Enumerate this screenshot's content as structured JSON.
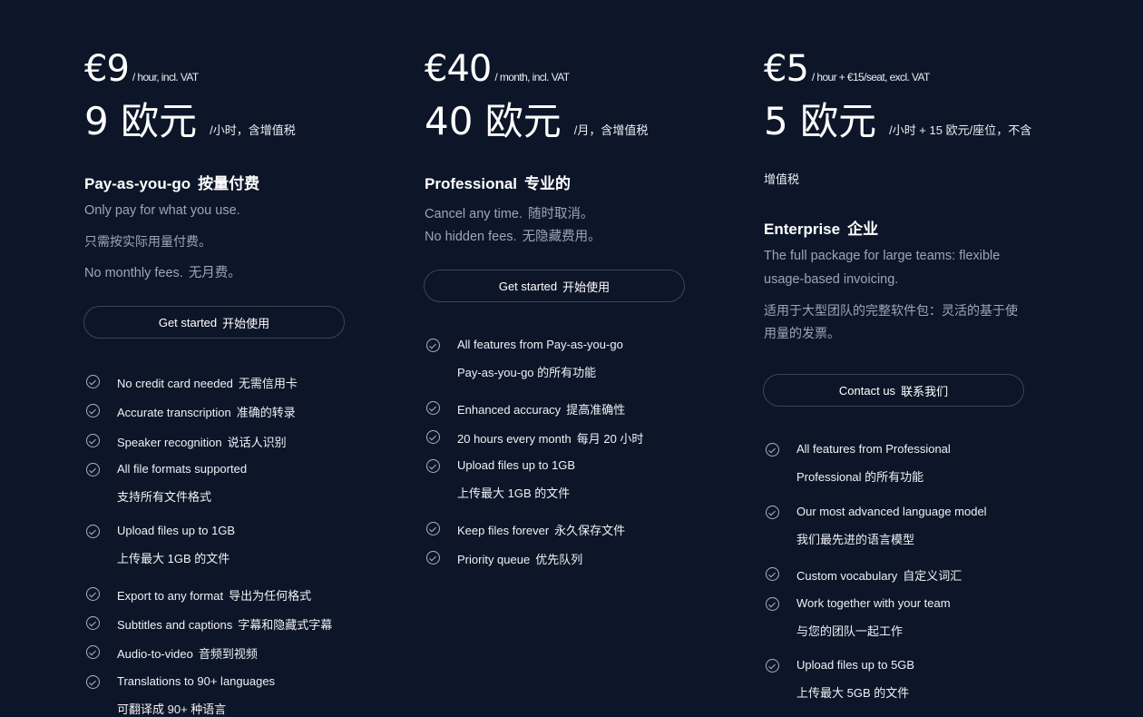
{
  "plans": [
    {
      "price_big": "€9",
      "price_unit": "/ hour, incl. VAT",
      "price_zh_big": "9 欧元",
      "price_zh_unit": "/小时，含增值税",
      "title_en": "Pay-as-you-go",
      "title_zh": "按量付费",
      "desc": [
        {
          "en": "Only pay for what you use.",
          "zh": ""
        },
        {
          "en": "",
          "zh": "只需按实际用量付费。"
        },
        {
          "en": "No monthly fees.",
          "zh": "无月费。"
        }
      ],
      "button_en": "Get started",
      "button_zh": "开始使用",
      "features": [
        {
          "en": "No credit card needed",
          "zh": "无需信用卡",
          "line2": ""
        },
        {
          "en": "Accurate transcription",
          "zh": "准确的转录",
          "line2": ""
        },
        {
          "en": "Speaker recognition",
          "zh": "说话人识别",
          "line2": ""
        },
        {
          "en": "All file formats supported",
          "zh": "",
          "line2": "支持所有文件格式"
        },
        {
          "en": "Upload files up to 1GB",
          "zh": "",
          "line2": "上传最大 1GB 的文件"
        },
        {
          "en": "Export to any format",
          "zh": "导出为任何格式",
          "line2": ""
        },
        {
          "en": "Subtitles and captions",
          "zh": "字幕和隐藏式字幕",
          "line2": ""
        },
        {
          "en": "Audio-to-video",
          "zh": "音频到视频",
          "line2": ""
        },
        {
          "en": "Translations to 90+ languages",
          "zh": "",
          "line2": "可翻译成 90+ 种语言"
        }
      ]
    },
    {
      "price_big": "€40",
      "price_unit": "/ month, incl. VAT",
      "price_zh_big": "40 欧元",
      "price_zh_unit": "/月，含增值税",
      "title_en": "Professional",
      "title_zh": "专业的",
      "desc": [
        {
          "en": "Cancel any time.",
          "zh": "随时取消。"
        },
        {
          "en": "No hidden fees.",
          "zh": "无隐藏费用。"
        }
      ],
      "button_en": "Get started",
      "button_zh": "开始使用",
      "features": [
        {
          "en": "All features from Pay-as-you-go",
          "zh": "",
          "line2": "Pay-as-you-go 的所有功能"
        },
        {
          "en": "Enhanced accuracy",
          "zh": "提高准确性",
          "line2": ""
        },
        {
          "en": "20 hours every month",
          "zh": "每月 20 小时",
          "line2": ""
        },
        {
          "en": "Upload files up to 1GB",
          "zh": "",
          "line2": "上传最大 1GB 的文件"
        },
        {
          "en": "Keep files forever",
          "zh": "永久保存文件",
          "line2": ""
        },
        {
          "en": "Priority queue",
          "zh": "优先队列",
          "line2": ""
        }
      ]
    },
    {
      "price_big": "€5",
      "price_unit": "/ hour + €15/seat, excl. VAT",
      "price_zh_big": "5 欧元",
      "price_zh_unit": "/小时 + 15 欧元/座位，不含",
      "price_zh_unit_cont": "增值税",
      "title_en": "Enterprise",
      "title_zh": "企业",
      "desc_lines": [
        "The full package for large teams: flexible",
        "usage-based invoicing."
      ],
      "desc_zh_lines": [
        "适用于大型团队的完整软件包：灵活的基于使",
        "用量的发票。"
      ],
      "button_en": "Contact us",
      "button_zh": "联系我们",
      "features": [
        {
          "en": "All features from Professional",
          "zh": "",
          "line2": "Professional 的所有功能"
        },
        {
          "en": "Our most advanced language model",
          "zh": "",
          "line2": "我们最先进的语言模型"
        },
        {
          "en": "Custom vocabulary",
          "zh": "自定义词汇",
          "line2": ""
        },
        {
          "en": "Work together with your team",
          "zh": "",
          "line2": "与您的团队一起工作"
        },
        {
          "en": "Upload files up to 5GB",
          "zh": "",
          "line2": "上传最大 5GB 的文件"
        }
      ]
    }
  ]
}
